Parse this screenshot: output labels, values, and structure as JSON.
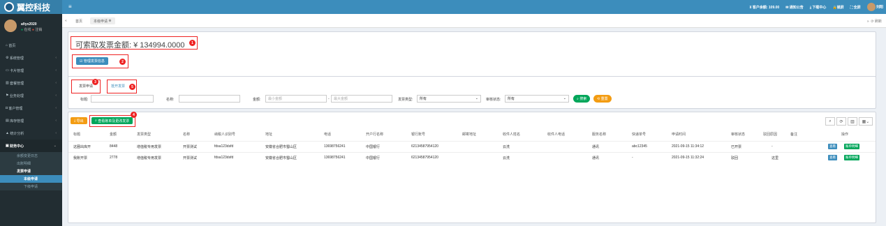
{
  "logo": {
    "text": "翼控科技"
  },
  "user": {
    "name": "afiyx2020",
    "online": "在线",
    "logout": "注销"
  },
  "menu": [
    {
      "label": "首页"
    },
    {
      "label": "系统管理"
    },
    {
      "label": "卡片管理"
    },
    {
      "label": "套餐管理"
    },
    {
      "label": "业务处理"
    },
    {
      "label": "客户管理"
    },
    {
      "label": "库存管理"
    },
    {
      "label": "统计分析"
    },
    {
      "label": "财务中心"
    }
  ],
  "submenu": {
    "balance_log": "余额变更日志",
    "recharge": "出账明细",
    "invoice_apply": "发票申请",
    "this_apply": "本级申请",
    "sub_apply": "下级申请"
  },
  "topbar": {
    "balance": "¥ 客户余额: 109.00",
    "notice": "通知公告",
    "download": "下载中心",
    "lock": "锁屏",
    "fullscreen": "全屏",
    "username": "刘阳"
  },
  "tabs": {
    "home": "首页",
    "current": "本级申请"
  },
  "tabbar_right": "刷新",
  "amount": {
    "label": "可索取发票金额:",
    "value": "¥ 134994.0000"
  },
  "manage_btn": "管理发票信息",
  "filter_tabs": {
    "apply": "发票申请",
    "open": "抵开发票"
  },
  "filters": {
    "title_label": "标题:",
    "name_label": "名称:",
    "amount_label": "金额:",
    "amount_min": "最小金额",
    "amount_max": "最大金额",
    "type_label": "发票类型:",
    "type_value": "所有",
    "status_label": "审核状态:",
    "status_value": "所有",
    "search": "搜索",
    "reset": "重置"
  },
  "toolbar": {
    "export": "导出",
    "view_bill": "查看账单及更改发票"
  },
  "columns": [
    "标题",
    "金额",
    "发票类型",
    "名称",
    "纳税人识别号",
    "地址",
    "电话",
    "开户行名称",
    "银行账号",
    "邮寄地址",
    "收件人姓名",
    "收件人电话",
    "服务名称",
    "快递单号",
    "申请时间",
    "审核状态",
    "驳回原因",
    "备注",
    "操作"
  ],
  "rows": [
    [
      "这圈出库开",
      "8448",
      "增值税专用发票",
      "开票测试",
      "fdsa123dsfd",
      "安徽省合肥市蜀山区",
      "13698756241",
      "中国银行",
      "62134587954120",
      "",
      "云洗",
      "",
      "通讯",
      "abc12345",
      "2021-09-15 11:34:12",
      "已开票",
      "-",
      ""
    ],
    [
      "我账开票",
      "2778",
      "增值税专用发票",
      "开票测试",
      "fdsa123dsfd",
      "安徽省合肥市蜀山区",
      "13698756241",
      "中国银行",
      "62134587954120",
      "",
      "云洗",
      "",
      "通讯",
      "-",
      "2021-09-15 11:32:24",
      "驳回",
      "这里",
      ""
    ]
  ],
  "row_actions": {
    "view": "查看",
    "view_bill": "账单明细"
  },
  "markers": [
    "1",
    "2",
    "3",
    "4",
    "5"
  ],
  "colors": {
    "primary": "#3c8dbc",
    "sidebar": "#222d32",
    "marker": "#e22222"
  }
}
